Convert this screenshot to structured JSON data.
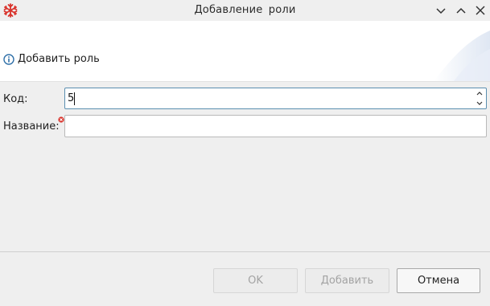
{
  "window": {
    "title": "Добавление роли",
    "controls": [
      "chevron-down-icon",
      "chevron-up-icon",
      "close-icon"
    ],
    "app_icon": "snowflake-icon",
    "app_icon_color": "#d9322b"
  },
  "header": {
    "message_icon": "info-icon",
    "message": "Добавить роль",
    "info_color": "#2e6fa8"
  },
  "form": {
    "code": {
      "label": "Код:",
      "value": "5"
    },
    "name": {
      "label": "Название:",
      "value": "",
      "error_icon": "error-icon",
      "error_color": "#d9322b"
    }
  },
  "buttons": {
    "ok": {
      "label": "OK",
      "enabled": false
    },
    "add": {
      "label": "Добавить",
      "enabled": false
    },
    "cancel": {
      "label": "Отмена",
      "enabled": true
    }
  }
}
